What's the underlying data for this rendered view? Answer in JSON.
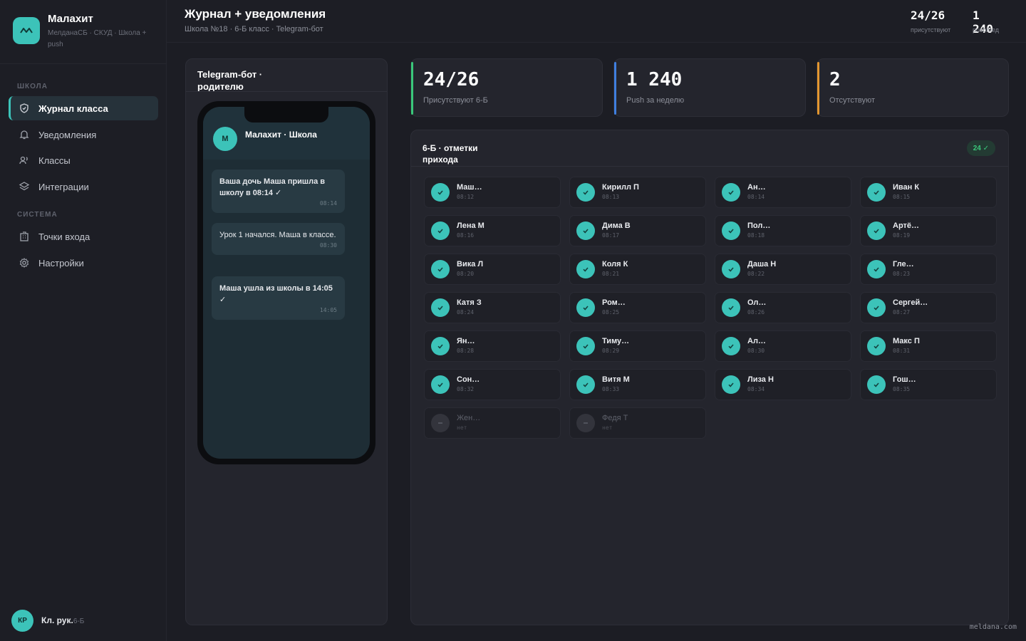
{
  "app": {
    "name": "Малахит",
    "subtitle": "МелданаСБ · СКУД · Школа + push",
    "accent": "#3cc3b9"
  },
  "sidebar": {
    "sections": [
      {
        "title": "ШКОЛА"
      },
      {
        "title": "СИСТЕМА"
      }
    ],
    "items": [
      {
        "label": "Журнал класса",
        "icon": "shield-icon",
        "active": true
      },
      {
        "label": "Уведомления",
        "icon": "bell-icon",
        "active": false
      },
      {
        "label": "Классы",
        "icon": "users-icon",
        "active": false
      },
      {
        "label": "Интеграции",
        "icon": "layers-icon",
        "active": false
      },
      {
        "label": "Точки входа",
        "icon": "building-icon",
        "active": false
      },
      {
        "label": "Настройки",
        "icon": "gear-icon",
        "active": false
      }
    ],
    "user": {
      "initials": "КР",
      "name": "Кл. рук.",
      "role": "6-Б"
    }
  },
  "header": {
    "title": "Журнал + уведомления",
    "subtitle": "Школа №18 · 6-Б класс · Telegram-бот",
    "stats": [
      {
        "value": "24/26",
        "label": "присутствуют"
      },
      {
        "value": "1 240",
        "label": "push/нед"
      }
    ]
  },
  "telegram": {
    "panel_title": "Telegram-бот · родителю",
    "chat": {
      "avatar": "М",
      "name": "Малахит · Школа"
    },
    "messages": [
      {
        "text_bold": "Ваша дочь Маша пришла в школу в 08:14 ✓",
        "text_normal": "",
        "time": "08:14"
      },
      {
        "text_bold": "",
        "text_normal": "Урок 1 начался. Маша в классе.",
        "time": "08:30"
      },
      {
        "text_bold": "Маша ушла из школы в 14:05 ✓",
        "text_normal": "",
        "time": "14:05"
      }
    ]
  },
  "stat_cards": [
    {
      "value": "24/26",
      "label": "Присутствуют 6-Б",
      "color": "#3ac77a"
    },
    {
      "value": "1 240",
      "label": "Push за неделю",
      "color": "#3f7fe0"
    },
    {
      "value": "2",
      "label": "Отсутствуют",
      "color": "#e3962f"
    }
  ],
  "attendance": {
    "title": "6-Б · отметки прихода",
    "badge": "24 ✓",
    "students": [
      {
        "name": "Маш…",
        "time": "08:12",
        "present": true
      },
      {
        "name": "Кирилл П",
        "time": "08:13",
        "present": true
      },
      {
        "name": "Ан…",
        "time": "08:14",
        "present": true
      },
      {
        "name": "Иван К",
        "time": "08:15",
        "present": true
      },
      {
        "name": "Лена М",
        "time": "08:16",
        "present": true
      },
      {
        "name": "Дима В",
        "time": "08:17",
        "present": true
      },
      {
        "name": "Пол…",
        "time": "08:18",
        "present": true
      },
      {
        "name": "Артё…",
        "time": "08:19",
        "present": true
      },
      {
        "name": "Вика Л",
        "time": "08:20",
        "present": true
      },
      {
        "name": "Коля К",
        "time": "08:21",
        "present": true
      },
      {
        "name": "Даша Н",
        "time": "08:22",
        "present": true
      },
      {
        "name": "Гле…",
        "time": "08:23",
        "present": true
      },
      {
        "name": "Катя З",
        "time": "08:24",
        "present": true
      },
      {
        "name": "Ром…",
        "time": "08:25",
        "present": true
      },
      {
        "name": "Ол…",
        "time": "08:26",
        "present": true
      },
      {
        "name": "Сергей…",
        "time": "08:27",
        "present": true
      },
      {
        "name": "Ян…",
        "time": "08:28",
        "present": true
      },
      {
        "name": "Тиму…",
        "time": "08:29",
        "present": true
      },
      {
        "name": "Ал…",
        "time": "08:30",
        "present": true
      },
      {
        "name": "Макс П",
        "time": "08:31",
        "present": true
      },
      {
        "name": "Сон…",
        "time": "08:32",
        "present": true
      },
      {
        "name": "Витя М",
        "time": "08:33",
        "present": true
      },
      {
        "name": "Лиза Н",
        "time": "08:34",
        "present": true
      },
      {
        "name": "Гош…",
        "time": "08:35",
        "present": true
      },
      {
        "name": "Жен…",
        "time": "нет",
        "present": false
      },
      {
        "name": "Федя Т",
        "time": "нет",
        "present": false
      }
    ]
  },
  "footer": {
    "mark": "meldana.com"
  }
}
